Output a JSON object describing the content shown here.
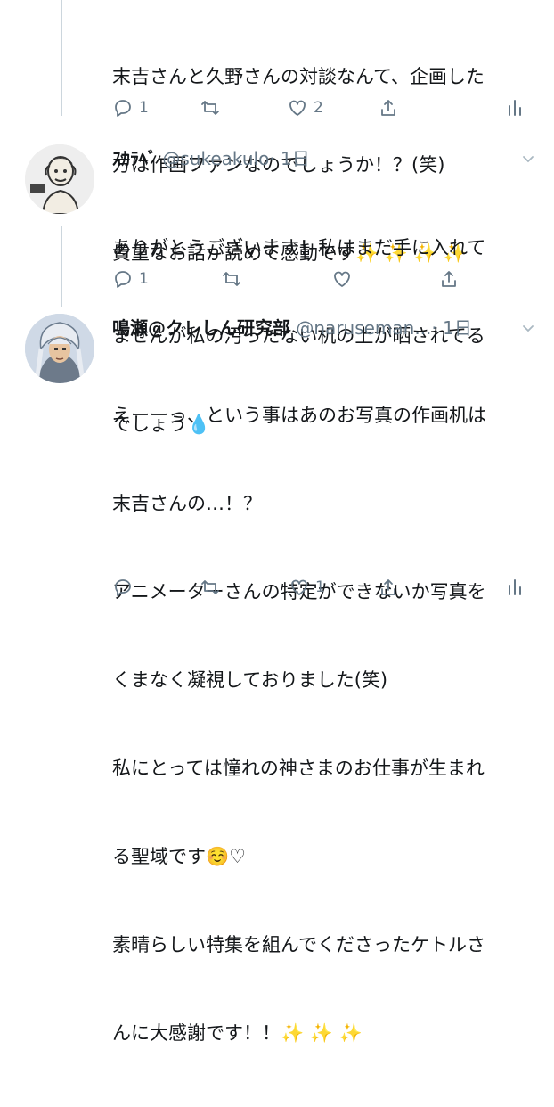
{
  "tweets": [
    {
      "body_lines": [
        "末吉さんと久野さんの対談なんて、企画した",
        "方は作画ファンなのでしょうか！？(笑)",
        "貴重なお話が読めて感動です✨ ✨ ✨ ✨"
      ],
      "reply_count": "1",
      "retweet_count": "",
      "like_count": "2"
    },
    {
      "display_name": "ｽｶﾗﾍﾞ",
      "handle": "@sukeakulo",
      "time": "· 1日",
      "body_lines": [
        "ありがとうございます！私はまだ手に入れて",
        "ませんが私の汚ったない机の上が晒されてる",
        "でしょう💧"
      ],
      "reply_count": "1",
      "retweet_count": "",
      "like_count": ""
    },
    {
      "display_name": "鳴瀬@クレしん研究部",
      "handle": "@naruseman...",
      "time": "· 1日",
      "body_lines": [
        "えーーっ、という事はあのお写真の作画机は",
        "末吉さんの…！？",
        "アニメーターさんの特定ができないか写真を",
        "くまなく凝視しておりました(笑)",
        "私にとっては憧れの神さまのお仕事が生まれ",
        "る聖域です☺️♡",
        "素晴らしい特集を組んでくださったケトルさ",
        "んに大感謝です！！✨ ✨ ✨"
      ],
      "reply_count": "",
      "retweet_count": "",
      "like_count": "1"
    }
  ]
}
